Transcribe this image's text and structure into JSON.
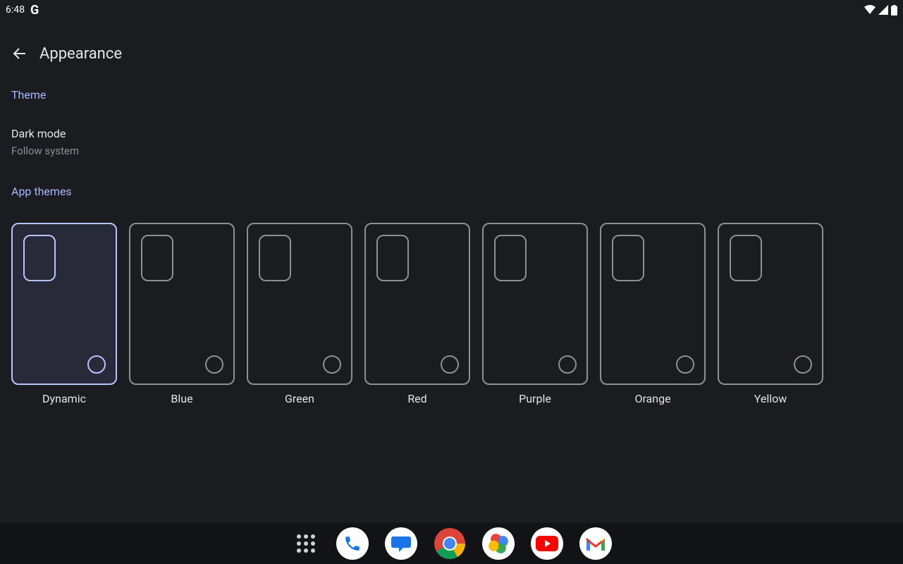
{
  "status_bar": {
    "time": "6:48",
    "g_label": "G"
  },
  "header": {
    "title": "Appearance"
  },
  "sections": {
    "theme": "Theme",
    "app_themes": "App themes"
  },
  "dark_mode": {
    "title": "Dark mode",
    "summary": "Follow system"
  },
  "themes": [
    {
      "label": "Dynamic",
      "selected": true
    },
    {
      "label": "Blue",
      "selected": false
    },
    {
      "label": "Green",
      "selected": false
    },
    {
      "label": "Red",
      "selected": false
    },
    {
      "label": "Purple",
      "selected": false
    },
    {
      "label": "Orange",
      "selected": false
    },
    {
      "label": "Yellow",
      "selected": false
    }
  ],
  "dock": {
    "apps": [
      "app-drawer-icon",
      "phone-icon",
      "messages-icon",
      "chrome-icon",
      "photos-icon",
      "youtube-icon",
      "gmail-icon"
    ]
  },
  "colors": {
    "background": "#1b1c20",
    "accent": "#a9b7ff",
    "selected_border": "#b8c4ff"
  }
}
